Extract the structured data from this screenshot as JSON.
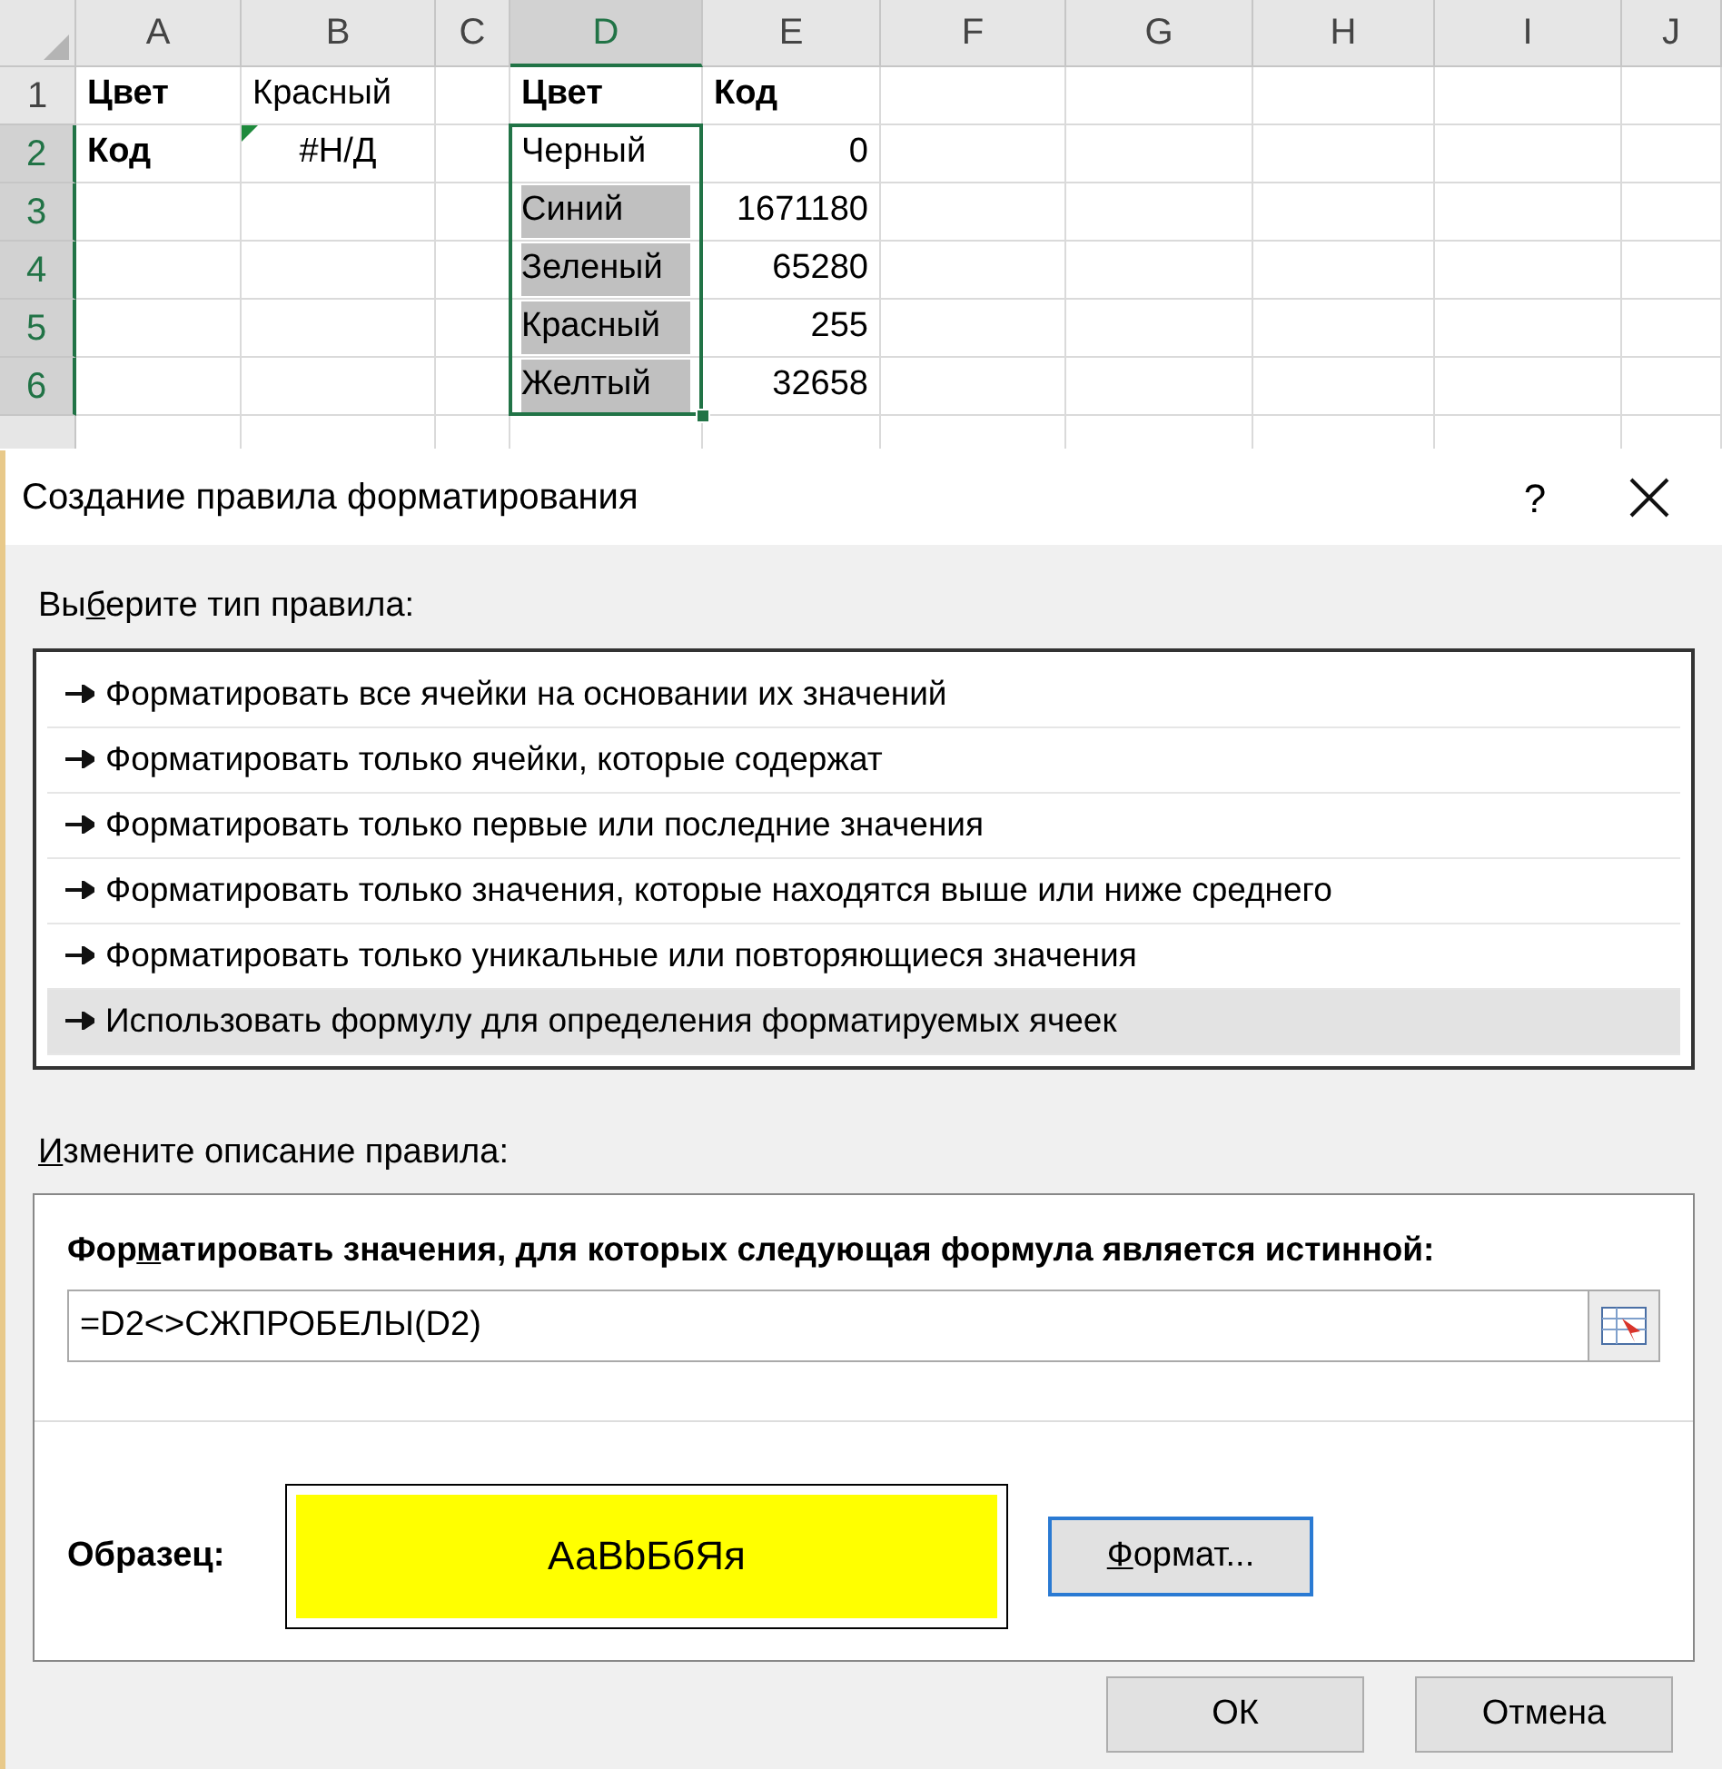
{
  "sheet": {
    "columns": [
      {
        "label": "A",
        "selected": false
      },
      {
        "label": "B",
        "selected": false
      },
      {
        "label": "C",
        "selected": false
      },
      {
        "label": "D",
        "selected": true
      },
      {
        "label": "E",
        "selected": false
      },
      {
        "label": "F",
        "selected": false
      },
      {
        "label": "G",
        "selected": false
      },
      {
        "label": "H",
        "selected": false
      },
      {
        "label": "I",
        "selected": false
      },
      {
        "label": "J",
        "selected": false
      }
    ],
    "rows": [
      {
        "number": "1",
        "selected": false,
        "cells": [
          {
            "text": "Цвет",
            "kind": "text",
            "bold": true
          },
          {
            "text": "Красный",
            "kind": "text"
          },
          {},
          {
            "text": "Цвет",
            "kind": "text",
            "bold": true
          },
          {
            "text": "Код",
            "kind": "text",
            "bold": true
          },
          {},
          {},
          {},
          {},
          {}
        ]
      },
      {
        "number": "2",
        "selected": true,
        "cells": [
          {
            "text": "Код",
            "kind": "text",
            "bold": true
          },
          {
            "text": "#Н/Д",
            "kind": "error",
            "error_flag": true
          },
          {},
          {
            "text": "Черный",
            "kind": "text",
            "selected": true,
            "highlighted": false
          },
          {
            "text": "0",
            "kind": "number"
          },
          {},
          {},
          {},
          {},
          {}
        ]
      },
      {
        "number": "3",
        "selected": true,
        "cells": [
          {},
          {},
          {},
          {
            "text": "Синий",
            "kind": "text",
            "selected": true,
            "highlighted": true
          },
          {
            "text": "1671180",
            "kind": "number"
          },
          {},
          {},
          {},
          {},
          {}
        ]
      },
      {
        "number": "4",
        "selected": true,
        "cells": [
          {},
          {},
          {},
          {
            "text": "Зеленый",
            "kind": "text",
            "selected": true,
            "highlighted": true
          },
          {
            "text": "65280",
            "kind": "number"
          },
          {},
          {},
          {},
          {},
          {}
        ]
      },
      {
        "number": "5",
        "selected": true,
        "cells": [
          {},
          {},
          {},
          {
            "text": "Красный",
            "kind": "text",
            "selected": true,
            "highlighted": true
          },
          {
            "text": "255",
            "kind": "number"
          },
          {},
          {},
          {},
          {},
          {}
        ]
      },
      {
        "number": "6",
        "selected": true,
        "cells": [
          {},
          {},
          {},
          {
            "text": "Желтый",
            "kind": "text",
            "selected": true,
            "highlighted": true
          },
          {
            "text": "32658",
            "kind": "number"
          },
          {},
          {},
          {},
          {},
          {}
        ]
      }
    ]
  },
  "dialog": {
    "title": "Создание правила форматирования",
    "help": "?",
    "rule_type_label": {
      "before": "Вы",
      "key": "б",
      "after": "ерите тип правила:"
    },
    "rule_types": [
      {
        "label": "Форматировать все ячейки на основании их значений",
        "selected": false
      },
      {
        "label": "Форматировать только ячейки, которые содержат",
        "selected": false
      },
      {
        "label": "Форматировать только первые или последние значения",
        "selected": false
      },
      {
        "label": "Форматировать только значения, которые находятся выше или ниже среднего",
        "selected": false
      },
      {
        "label": "Форматировать только уникальные или повторяющиеся значения",
        "selected": false
      },
      {
        "label": "Использовать формулу для определения форматируемых ячеек",
        "selected": true
      }
    ],
    "description_label": {
      "key": "И",
      "after": "змените описание правила:"
    },
    "formula_label": {
      "before": "Фор",
      "key": "м",
      "after": "атировать значения, для которых следующая формула является истинной:"
    },
    "formula": "=D2<>СЖПРОБЕЛЫ(D2)",
    "preview_label": "Образец:",
    "preview_text": "АаBbБбЯя",
    "format_button": {
      "key": "Ф",
      "after": "ормат..."
    },
    "buttons": [
      "ОК",
      "Отмена"
    ]
  }
}
